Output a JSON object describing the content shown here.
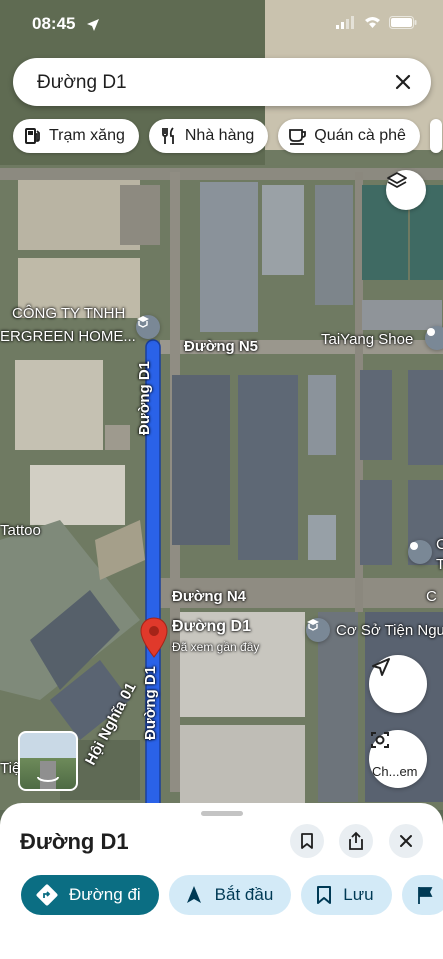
{
  "status": {
    "time": "08:45"
  },
  "search": {
    "query": "Đường D1"
  },
  "chips": [
    {
      "label": "Trạm xăng",
      "icon": "gas-station-icon"
    },
    {
      "label": "Nhà hàng",
      "icon": "restaurant-icon"
    },
    {
      "label": "Quán cà phê",
      "icon": "coffee-icon"
    }
  ],
  "map_labels": {
    "company": "CÔNG TY TNHH",
    "company2": "ERGREEN HOME...",
    "n5": "Đường N5",
    "taiyang": "TaiYang Shoe",
    "d1_vertical": "Đường D1",
    "d1_vertical2": "Đường D1",
    "tattoo": "Tattoo",
    "n4": "Đường N4",
    "pin_title": "Đường D1",
    "pin_sub": "Đã xem gần đây",
    "co_so": "Cơ Sở Tiện Ngu",
    "hoi_nghia": "Hội Nghĩa 01",
    "nail": "Tiệ  nail - mi",
    "chem": "Ch...em",
    "right_o": "C",
    "right_t": "T",
    "right_c": "C"
  },
  "sheet": {
    "title": "Đường D1",
    "actions": [
      {
        "label": "Đường đi"
      },
      {
        "label": "Bắt đầu"
      },
      {
        "label": "Lưu"
      }
    ]
  },
  "colors": {
    "route": "#2a62e8",
    "accent": "#0b6e83",
    "pin": "#e0392b"
  }
}
